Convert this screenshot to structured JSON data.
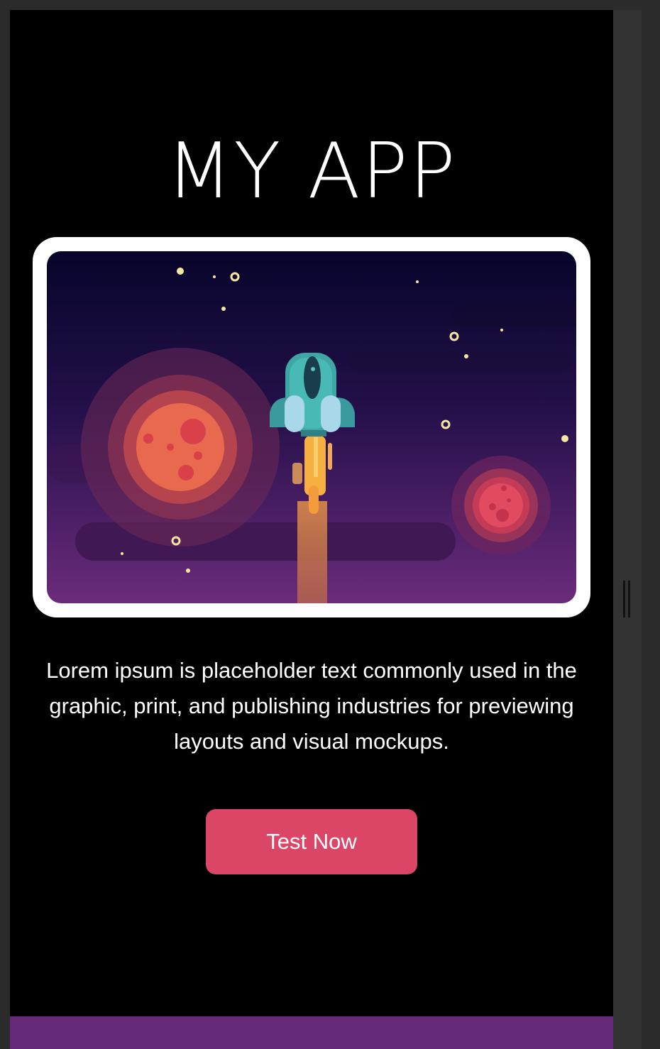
{
  "app": {
    "title": "MY APP"
  },
  "hero": {
    "illustration": "rocket-launch-space-illustration",
    "colors": {
      "sky_top": "#07052a",
      "sky_bottom": "#6b2b7b",
      "planet_large": "#e8694e",
      "planet_small": "#e24a5f",
      "rocket_body": "#3fa6a6",
      "rocket_flame": "#f5b041"
    }
  },
  "content": {
    "description": "Lorem ipsum is placeholder text commonly used in the graphic, print, and publishing industries for previewing layouts and visual mockups."
  },
  "actions": {
    "primary_label": "Test Now"
  },
  "theme": {
    "background": "#000000",
    "button_color": "#db4667",
    "bottom_bar_color": "#672a7a"
  },
  "icons": {
    "drag_handle": "resize-handle-icon"
  }
}
